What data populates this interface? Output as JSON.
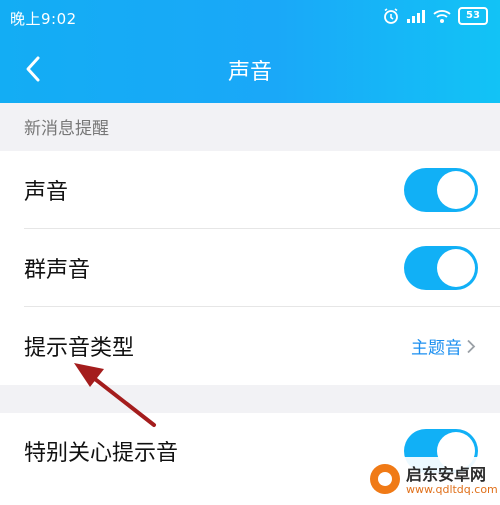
{
  "status_bar": {
    "time": "晚上9:02",
    "battery": "53"
  },
  "nav": {
    "title": "声音"
  },
  "sections": {
    "new_message": {
      "label": "新消息提醒",
      "rows": {
        "sound": {
          "label": "声音",
          "enabled": true
        },
        "group_sound": {
          "label": "群声音",
          "enabled": true
        },
        "tone_type": {
          "label": "提示音类型",
          "value": "主题音"
        }
      }
    },
    "special": {
      "rows": {
        "special_care": {
          "label": "特别关心提示音",
          "enabled": true
        }
      }
    }
  },
  "watermark": {
    "text": "启东安卓网",
    "url": "www.qdltdq.com"
  },
  "colors": {
    "accent": "#11b0f6",
    "header": "#13adf4",
    "link": "#1b8ff0",
    "arrow": "#a41d1d"
  }
}
